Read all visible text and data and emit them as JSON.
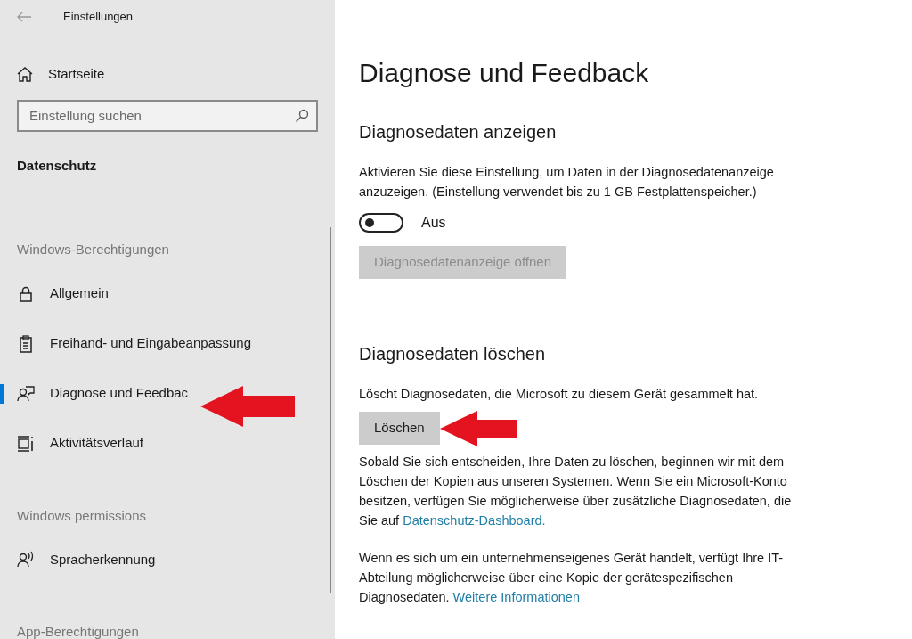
{
  "sidebar": {
    "title": "Einstellungen",
    "home": "Startseite",
    "search": {
      "placeholder": "Einstellung suchen"
    },
    "category": "Datenschutz",
    "groups": [
      {
        "heading": "Windows-Berechtigungen",
        "items": [
          {
            "label": "Allgemein",
            "kind": "lock",
            "selected": false
          },
          {
            "label": "Freihand- und Eingabeanpassung",
            "kind": "clipboard",
            "selected": false
          },
          {
            "label": "Diagnose und Feedbac",
            "kind": "feedback",
            "selected": true
          },
          {
            "label": "Aktivitätsverlauf",
            "kind": "timeline",
            "selected": false
          }
        ]
      },
      {
        "heading": "Windows permissions",
        "items": [
          {
            "label": "Spracherkennung",
            "kind": "speech",
            "selected": false
          }
        ]
      },
      {
        "heading": "App-Berechtigungen"
      }
    ]
  },
  "main": {
    "title": "Diagnose und Feedback",
    "sections": [
      {
        "heading": "Diagnosedaten anzeigen",
        "paragraphs": [
          {
            "text": "Aktivieren Sie diese Einstellung, um Daten in der Diagnosedatenanzeige anzuzeigen. (Einstellung verwendet bis zu 1 GB Festplattenspeicher.)"
          }
        ],
        "toggle": {
          "on": false,
          "label": "Aus"
        },
        "button": {
          "label": "Diagnosedatenanzeige öffnen",
          "disabled": true
        }
      },
      {
        "heading": "Diagnosedaten löschen",
        "paragraphs": [
          {
            "text": "Löscht Diagnosedaten, die Microsoft zu diesem Gerät gesammelt hat."
          }
        ],
        "button": {
          "label": "Löschen",
          "disabled": false
        },
        "notes": [
          {
            "text": "Sobald Sie sich entscheiden, Ihre Daten zu löschen, beginnen wir mit dem Löschen der Kopien aus unseren Systemen. Wenn Sie ein Microsoft-Konto besitzen, verfügen Sie möglicherweise über zusätzliche Diagnosedaten, die Sie auf ",
            "link": "Datenschutz-Dashboard."
          },
          {
            "text": "Wenn es sich um ein unternehmenseigenes Gerät handelt, verfügt Ihre IT-Abteilung möglicherweise über eine Kopie der gerätespezifischen Diagnosedaten. ",
            "link": "Weitere Informationen"
          }
        ]
      }
    ]
  }
}
